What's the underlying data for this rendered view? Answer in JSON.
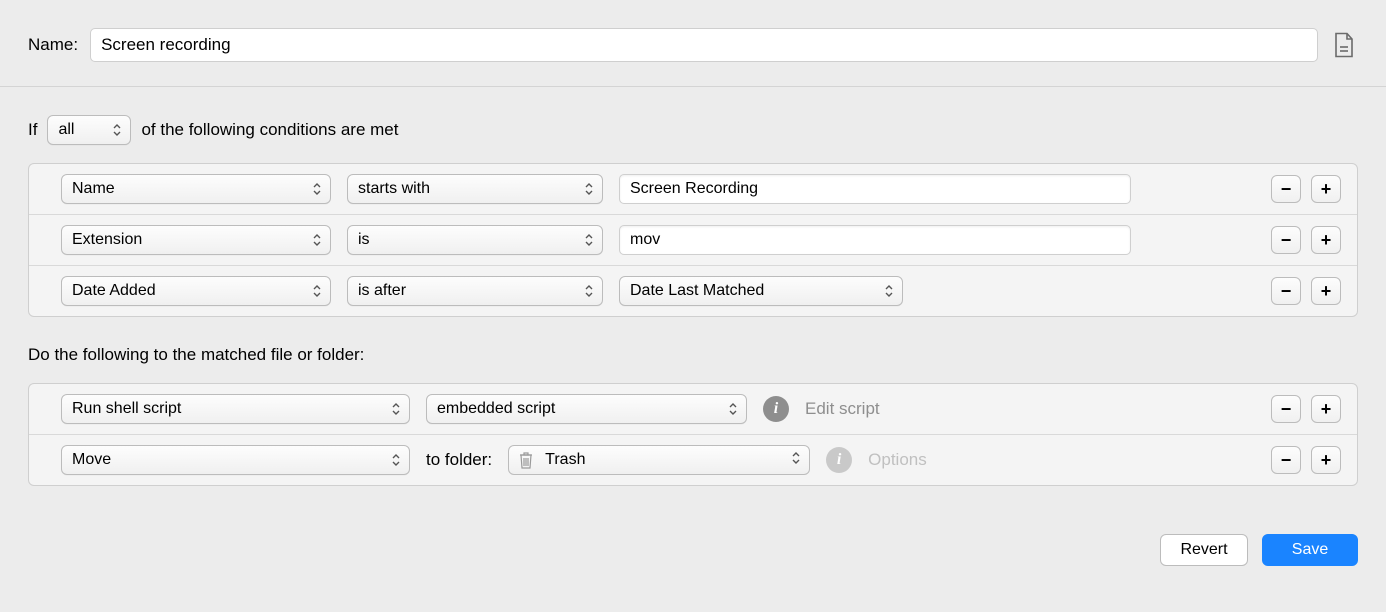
{
  "header": {
    "name_label": "Name:",
    "name_value": "Screen recording"
  },
  "conditions": {
    "prefix": "If",
    "mode": "all",
    "suffix": "of the following conditions are met",
    "rows": [
      {
        "attr": "Name",
        "op": "starts with",
        "value_text": "Screen Recording"
      },
      {
        "attr": "Extension",
        "op": "is",
        "value_text": "mov"
      },
      {
        "attr": "Date Added",
        "op": "is after",
        "value_popup": "Date Last Matched"
      }
    ]
  },
  "actions": {
    "heading": "Do the following to the matched file or folder:",
    "rows": [
      {
        "action": "Run shell script",
        "arg_popup": "embedded script",
        "aux_label": "Edit script"
      },
      {
        "action": "Move",
        "to_folder_label": "to folder:",
        "folder": "Trash",
        "aux_label": "Options"
      }
    ]
  },
  "footer": {
    "revert": "Revert",
    "save": "Save"
  },
  "glyphs": {
    "minus": "−",
    "plus": "+"
  }
}
